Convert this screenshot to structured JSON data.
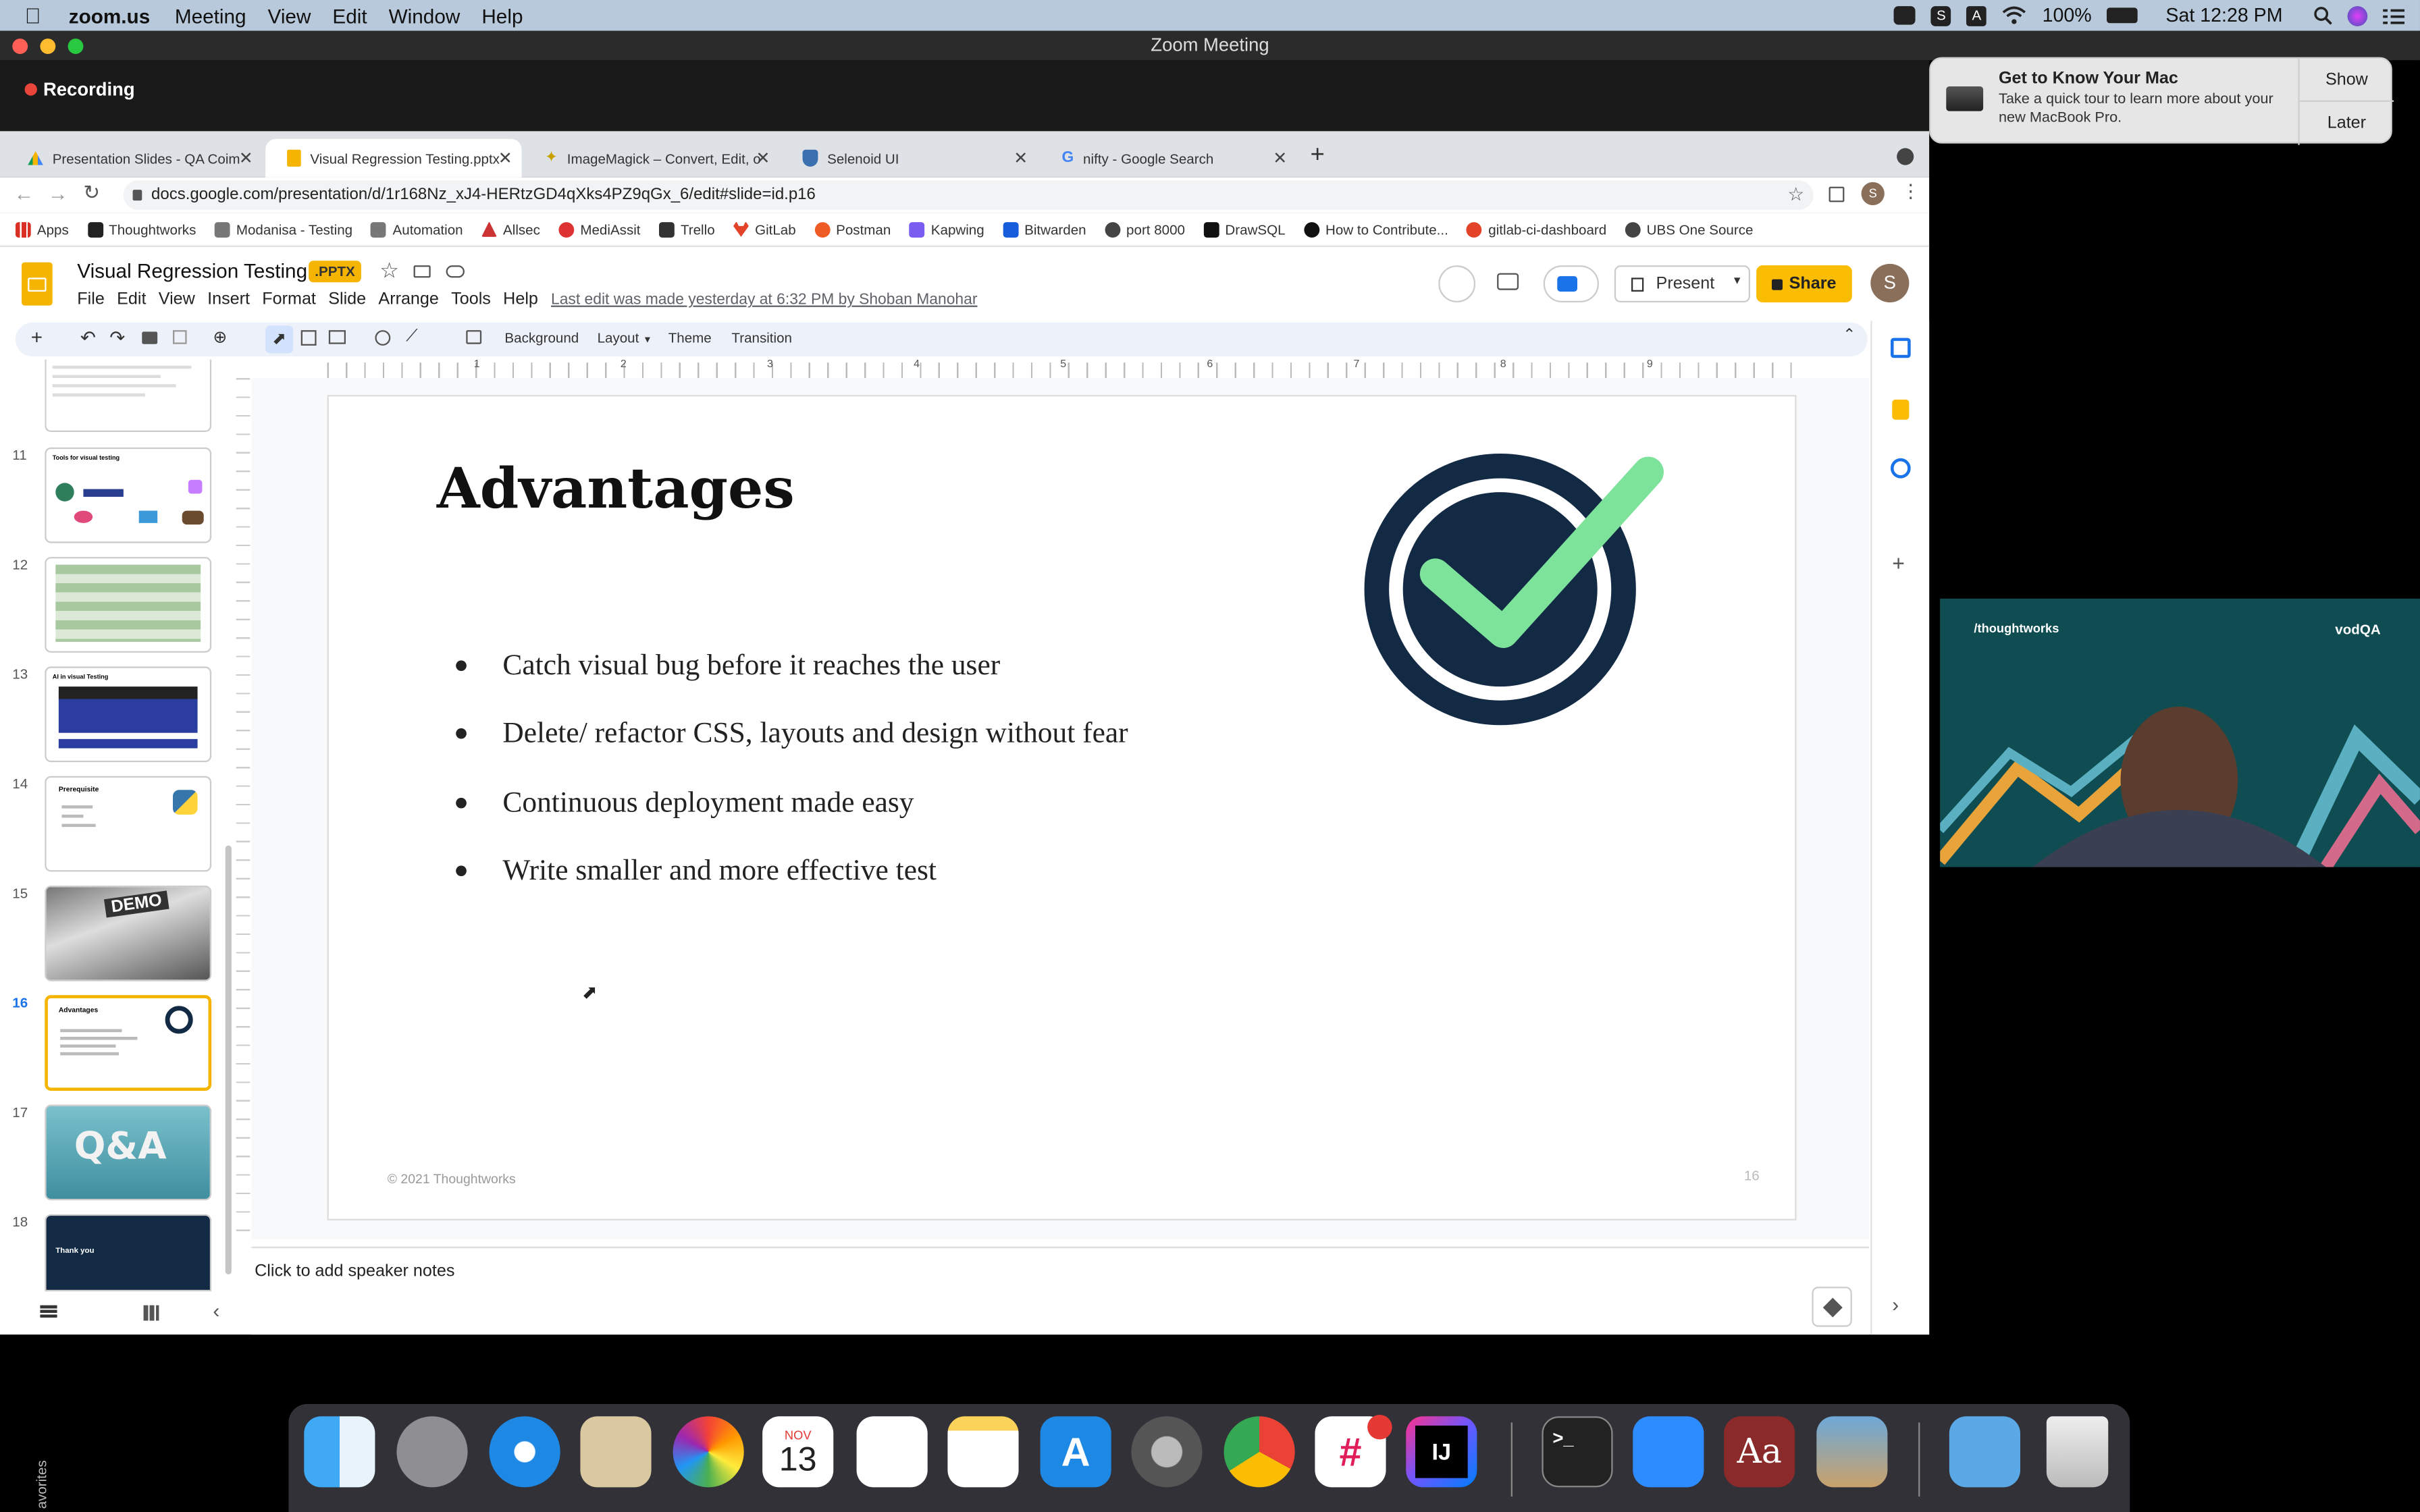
{
  "menubar": {
    "app_name": "zoom.us",
    "items": [
      "Meeting",
      "View",
      "Edit",
      "Window",
      "Help"
    ],
    "battery": "100%",
    "clock": "Sat 12:28 PM"
  },
  "zoom": {
    "window_title": "Zoom Meeting",
    "recording_label": "Recording"
  },
  "browser": {
    "tabs": [
      {
        "label": "Presentation Slides - QA Coim"
      },
      {
        "label": "Visual Regression Testing.pptx"
      },
      {
        "label": "ImageMagick – Convert, Edit, o"
      },
      {
        "label": "Selenoid UI"
      },
      {
        "label": "nifty - Google Search"
      }
    ],
    "url": "docs.google.com/presentation/d/1r168Nz_xJ4-HERtzGD4qXks4PZ9qGx_6/edit#slide=id.p16",
    "profile_letter": "S",
    "bookmarks": [
      {
        "label": "Apps",
        "color": "#4285f4"
      },
      {
        "label": "Thoughtworks",
        "color": "#222"
      },
      {
        "label": "Modanisa - Testing",
        "color": "#777"
      },
      {
        "label": "Automation",
        "color": "#777"
      },
      {
        "label": "Allsec",
        "color": "#c33"
      },
      {
        "label": "MediAssit",
        "color": "#d33"
      },
      {
        "label": "Trello",
        "color": "#333"
      },
      {
        "label": "GitLab",
        "color": "#e24329"
      },
      {
        "label": "Postman",
        "color": "#ef5b25"
      },
      {
        "label": "Kapwing",
        "color": "#7a5cf0"
      },
      {
        "label": "Bitwarden",
        "color": "#175ddc"
      },
      {
        "label": "port 8000",
        "color": "#444"
      },
      {
        "label": "DrawSQL",
        "color": "#111"
      },
      {
        "label": "How to Contribute...",
        "color": "#111"
      },
      {
        "label": "gitlab-ci-dashboard",
        "color": "#e24329"
      },
      {
        "label": "UBS One Source",
        "color": "#444"
      }
    ]
  },
  "slides_app": {
    "doc_title": "Visual Regression Testing",
    "badge": ".PPTX",
    "menus": [
      "File",
      "Edit",
      "View",
      "Insert",
      "Format",
      "Slide",
      "Arrange",
      "Tools",
      "Help"
    ],
    "last_edit": "Last edit was made yesterday at 6:32 PM by Shoban Manohar",
    "present_label": "Present",
    "share_label": "Share",
    "avatar_letter": "S",
    "toolbar": {
      "background": "Background",
      "layout": "Layout",
      "theme": "Theme",
      "transition": "Transition"
    },
    "ruler_numbers": [
      "1",
      "2",
      "3",
      "4",
      "5",
      "6",
      "7",
      "8",
      "9"
    ],
    "speaker_notes_placeholder": "Click to add speaker notes"
  },
  "filmstrip": [
    {
      "num": "11",
      "title": "Tools for visual testing"
    },
    {
      "num": "12",
      "title": ""
    },
    {
      "num": "13",
      "title": "AI in visual Testing"
    },
    {
      "num": "14",
      "title": "Prerequisite"
    },
    {
      "num": "15",
      "title": "DEMO"
    },
    {
      "num": "16",
      "title": "Advantages"
    },
    {
      "num": "17",
      "title": "Q&A"
    },
    {
      "num": "18",
      "title": "Thank you"
    }
  ],
  "slide": {
    "title": "Advantages",
    "bullets": [
      "Catch visual bug before it reaches the user",
      "Delete/ refactor CSS, layouts and design without fear",
      "Continuous deployment made easy",
      "Write smaller and more effective test"
    ],
    "copyright": "© 2021 Thoughtworks",
    "page_number": "16",
    "colors": {
      "check": "#7ee39a",
      "ring": "#132a45"
    }
  },
  "notification": {
    "title": "Get to Know Your Mac",
    "body": "Take a quick tour to learn more about your new MacBook Pro.",
    "show_label": "Show",
    "later_label": "Later"
  },
  "video": {
    "left_logo": "/thoughtworks",
    "right_logo": "vodQA"
  },
  "dock": {
    "calendar_month": "NOV",
    "calendar_day": "13",
    "favorites_label": "avorites"
  }
}
